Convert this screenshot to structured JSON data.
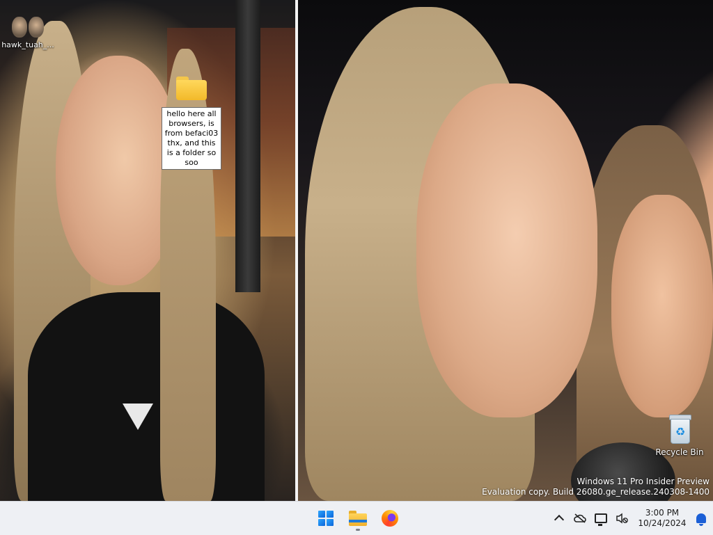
{
  "desktop": {
    "icons": [
      {
        "label": "hawk_tuah_...",
        "icon": "video-thumbnail-icon"
      },
      {
        "label": "hello here all browsers, is from befaci03 thx, and this is a folder so soo",
        "icon": "folder-icon",
        "state": "renaming"
      },
      {
        "label": "Recycle Bin",
        "icon": "recycle-bin-icon"
      }
    ]
  },
  "watermark": {
    "line1": "Windows 11 Pro Insider Preview",
    "line2": "Evaluation copy. Build 26080.ge_release.240308-1400"
  },
  "taskbar": {
    "apps": [
      {
        "name": "Start",
        "icon": "windows-logo-icon"
      },
      {
        "name": "File Explorer",
        "icon": "file-explorer-icon",
        "running": true
      },
      {
        "name": "Firefox",
        "icon": "firefox-icon"
      }
    ],
    "tray": {
      "icons": [
        "chevron-up-icon",
        "cloud-off-icon",
        "network-icon",
        "volume-muted-icon",
        "notification-bell-icon"
      ],
      "time": "3:00 PM",
      "date": "10/24/2024"
    }
  },
  "colors": {
    "taskbar_bg": "#eef0f4",
    "accent": "#1b5fd6",
    "folder": "#f2b92a"
  }
}
